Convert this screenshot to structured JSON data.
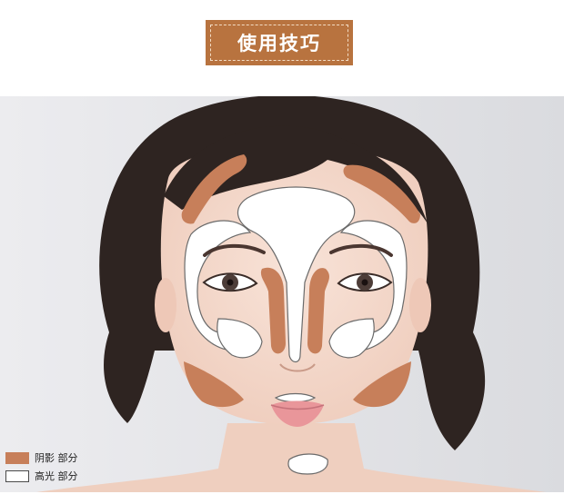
{
  "title": "使用技巧",
  "legend": {
    "shadow_label": "阴影 部分",
    "highlight_label": "高光 部分"
  },
  "colors": {
    "badge": "#b8733f",
    "shadow": "#c77f5a",
    "highlight": "#ffffff"
  }
}
